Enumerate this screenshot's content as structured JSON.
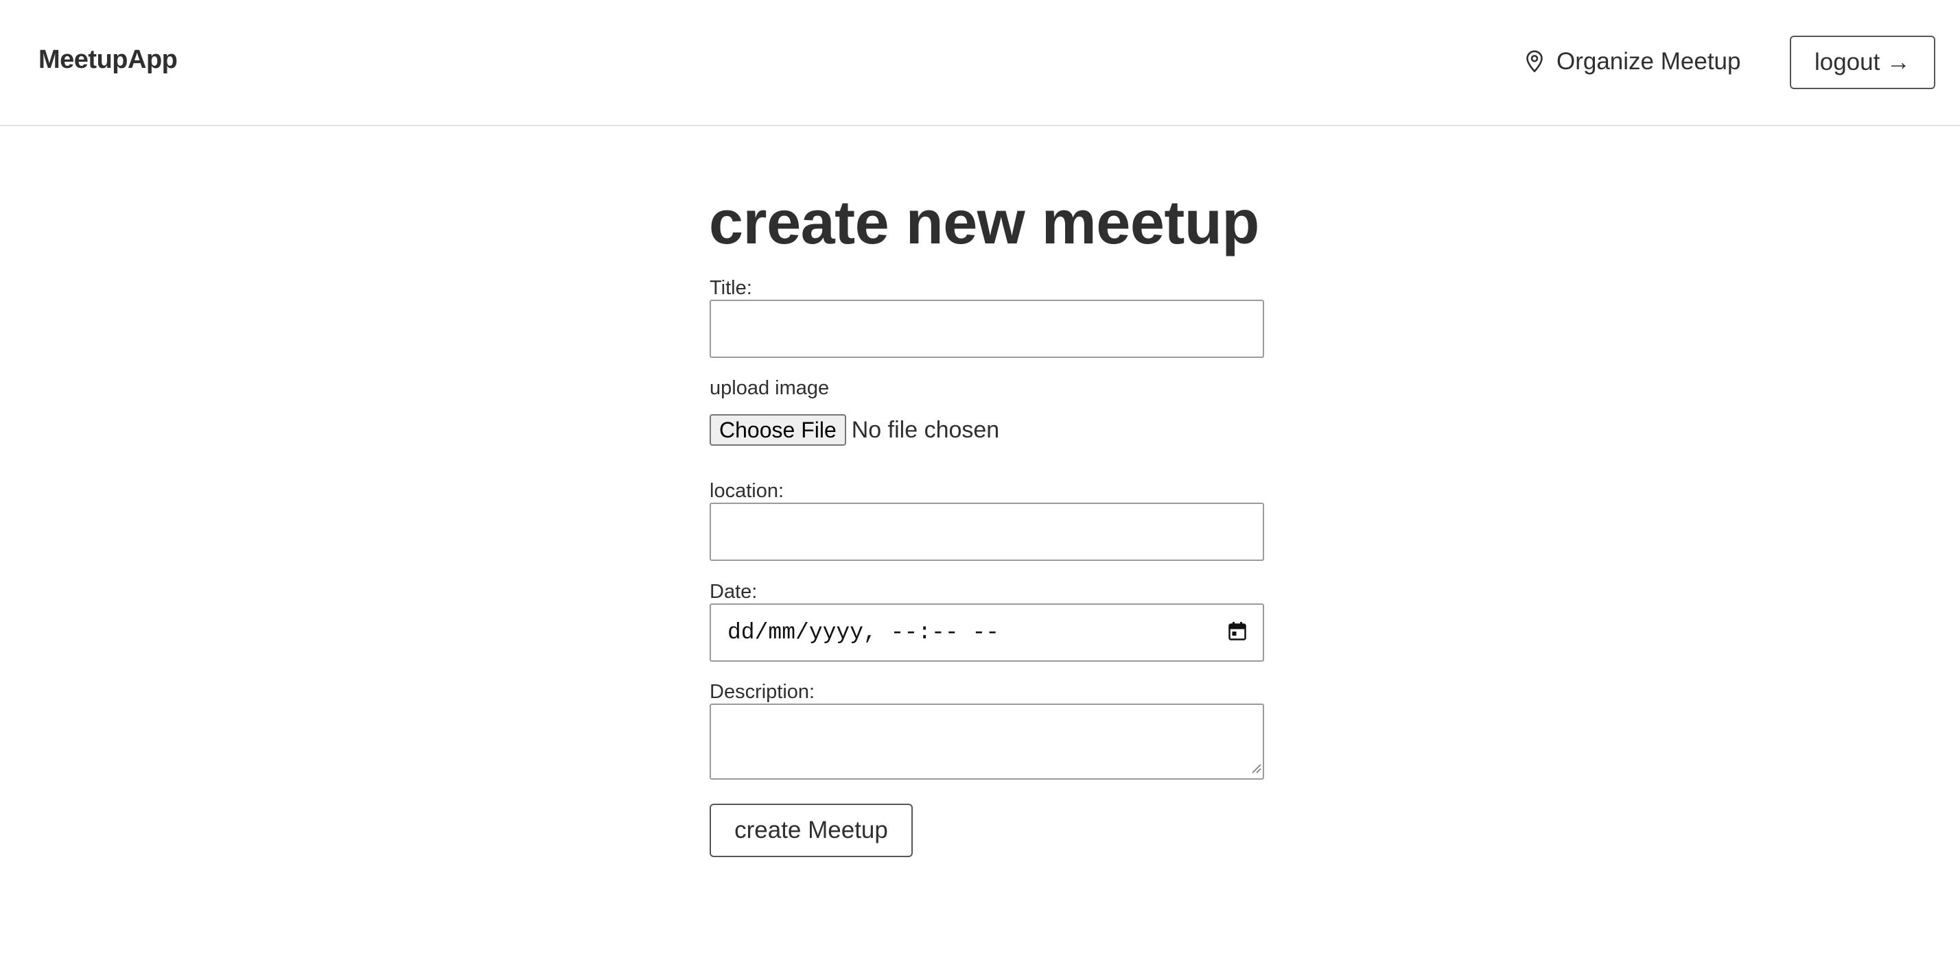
{
  "header": {
    "logo": "MeetupApp",
    "organize_label": "Organize Meetup",
    "organize_icon": "map-pin-icon",
    "logout_label": "logout →"
  },
  "main": {
    "title": "create new meetup",
    "form": {
      "title_label": "Title:",
      "title_value": "",
      "image_label": "upload image",
      "file_button_label": "Choose File",
      "file_status": "No file chosen",
      "location_label": "location:",
      "location_value": "",
      "date_label": "Date:",
      "date_placeholder": "dd/mm/yyyy, --:-- --",
      "date_icon": "calendar-icon",
      "description_label": "Description:",
      "description_value": "",
      "submit_label": "create Meetup"
    }
  },
  "colors": {
    "text": "#2f2f2f",
    "border": "#9a9a9a",
    "button_border": "#555555",
    "background": "#ffffff",
    "header_divider": "#e2e2e2"
  }
}
